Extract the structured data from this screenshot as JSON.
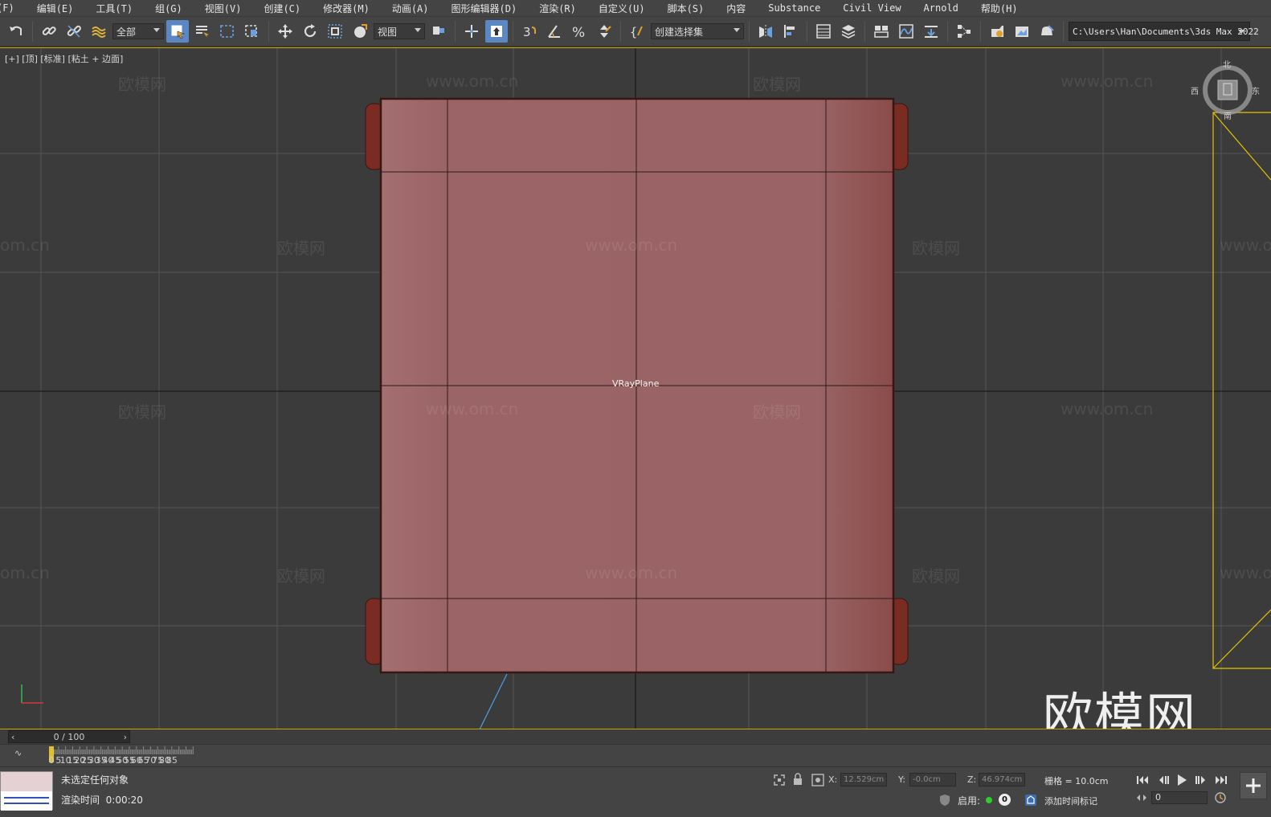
{
  "menu": [
    "(F)",
    "编辑(E)",
    "工具(T)",
    "组(G)",
    "视图(V)",
    "创建(C)",
    "修改器(M)",
    "动画(A)",
    "图形编辑器(D)",
    "渲染(R)",
    "自定义(U)",
    "脚本(S)",
    "内容",
    "Substance",
    "Civil View",
    "Arnold",
    "帮助(H)"
  ],
  "toolbar": {
    "filter_value": "全部",
    "refcoord_value": "视图",
    "named_selection_value": "创建选择集",
    "project_path": "C:\\Users\\Han\\Documents\\3ds Max 2022"
  },
  "viewport": {
    "label": "[+] [顶] [标准] [粘土 + 边面]",
    "object_label": "VRayPlane",
    "watermark_text": "欧模网",
    "watermark_url": "www.om.cn",
    "watermark_url_partial": "om.cn",
    "big_watermark": "欧模网",
    "viewcube": {
      "n": "北",
      "s": "南",
      "w": "西",
      "e": "东"
    },
    "object_color": "#9a6466",
    "object_edge_color": "#3a1612",
    "grid_color": "#555555",
    "axis_color": "#111111",
    "selection_color": "#e6c200"
  },
  "timeline": {
    "slider_value": "0 / 100",
    "ticks": [
      "0",
      "5",
      "10",
      "15",
      "20",
      "25",
      "30",
      "35",
      "40",
      "45",
      "50",
      "55",
      "60",
      "65",
      "70",
      "75",
      "80",
      "85"
    ]
  },
  "status": {
    "message": "未选定任何对象",
    "render_time_label": "渲染时间",
    "render_time_value": "0:00:20",
    "x_label": "X:",
    "x_value": "12.529cm",
    "y_label": "Y:",
    "y_value": "-0.0cm",
    "z_label": "Z:",
    "z_value": "46.974cm",
    "grid_text": "栅格 = 10.0cm",
    "enable_label": "启用:",
    "zero_value": "0",
    "add_time_tag": "添加时间标记",
    "frame_value": "0"
  }
}
